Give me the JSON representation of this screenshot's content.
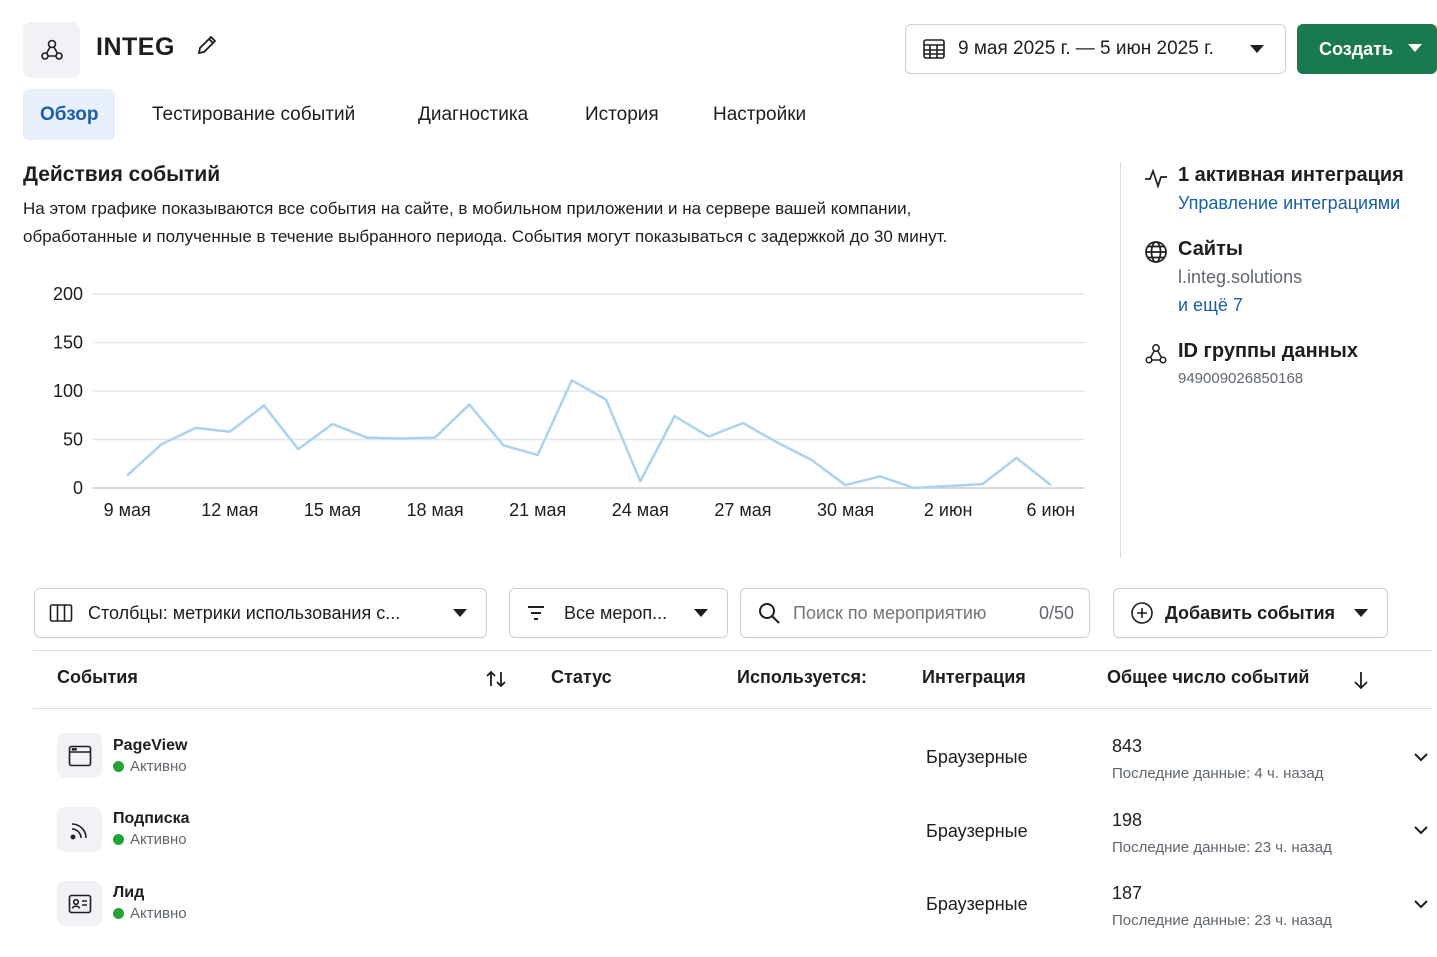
{
  "header": {
    "title": "INTEG",
    "date_range": "9 мая 2025 г. — 5 июн 2025 г.",
    "create_label": "Создать"
  },
  "tabs": [
    {
      "label": "Обзор",
      "active": true
    },
    {
      "label": "Тестирование событий"
    },
    {
      "label": "Диагностика"
    },
    {
      "label": "История"
    },
    {
      "label": "Настройки"
    }
  ],
  "section": {
    "title": "Действия событий",
    "description_line1": "На этом графике показываются все события на сайте, в мобильном приложении и на сервере вашей компании,",
    "description_line2": "обработанные и полученные в течение выбранного периода. События могут показываться с задержкой до 30 минут."
  },
  "side_panel": {
    "integrations_title": "1 активная интеграция",
    "integrations_link": "Управление интеграциями",
    "sites_title": "Сайты",
    "site_name": "l.integ.solutions",
    "sites_more": "и ещё 7",
    "dataset_title": "ID группы данных",
    "dataset_id": "949009026850168"
  },
  "chart_data": {
    "type": "line",
    "ylim": [
      0,
      200
    ],
    "yticks": [
      "0",
      "50",
      "100",
      "150",
      "200"
    ],
    "xtick_labels": [
      "9 мая",
      "12 мая",
      "15 мая",
      "18 мая",
      "21 мая",
      "24 мая",
      "27 мая",
      "30 мая",
      "2 июн",
      "6 июн"
    ],
    "xtick_positions": [
      1,
      4,
      7,
      10,
      13,
      16,
      19,
      22,
      25,
      28
    ],
    "grid": true,
    "line_color": "#a9d3f0",
    "series": [
      {
        "x": [
          1,
          2,
          3,
          4,
          5,
          6,
          7,
          8,
          9,
          10,
          11,
          12,
          13,
          14,
          15,
          16,
          17,
          18,
          19,
          20,
          21,
          22,
          23,
          24,
          25,
          26,
          27,
          28,
          29
        ],
        "values": [
          13,
          45,
          62,
          58,
          85,
          40,
          66,
          52,
          51,
          52,
          86,
          44,
          34,
          111,
          91,
          7,
          74,
          53,
          67,
          47,
          29,
          3,
          12,
          0,
          2,
          4,
          31,
          3,
          null
        ]
      }
    ]
  },
  "toolbar": {
    "columns_label": "Столбцы: метрики использования с...",
    "filter_label": "Все мероп...",
    "search_placeholder": "Поиск по мероприятию",
    "search_count": "0/50",
    "add_events_label": "Добавить события"
  },
  "table": {
    "headers": {
      "events": "События",
      "status": "Статус",
      "used": "Используется:",
      "integration": "Интеграция",
      "total": "Общее число событий"
    },
    "rows": [
      {
        "name": "PageView",
        "status": "Активно",
        "integration": "Браузерные",
        "count": "843",
        "last": "Последние данные: 4 ч. назад",
        "icon": "browser-window-icon"
      },
      {
        "name": "Подписка",
        "status": "Активно",
        "integration": "Браузерные",
        "count": "198",
        "last": "Последние данные: 23 ч. назад",
        "icon": "rss-feed-icon"
      },
      {
        "name": "Лид",
        "status": "Активно",
        "integration": "Браузерные",
        "count": "187",
        "last": "Последние данные: 23 ч. назад",
        "icon": "contact-card-icon"
      }
    ]
  }
}
